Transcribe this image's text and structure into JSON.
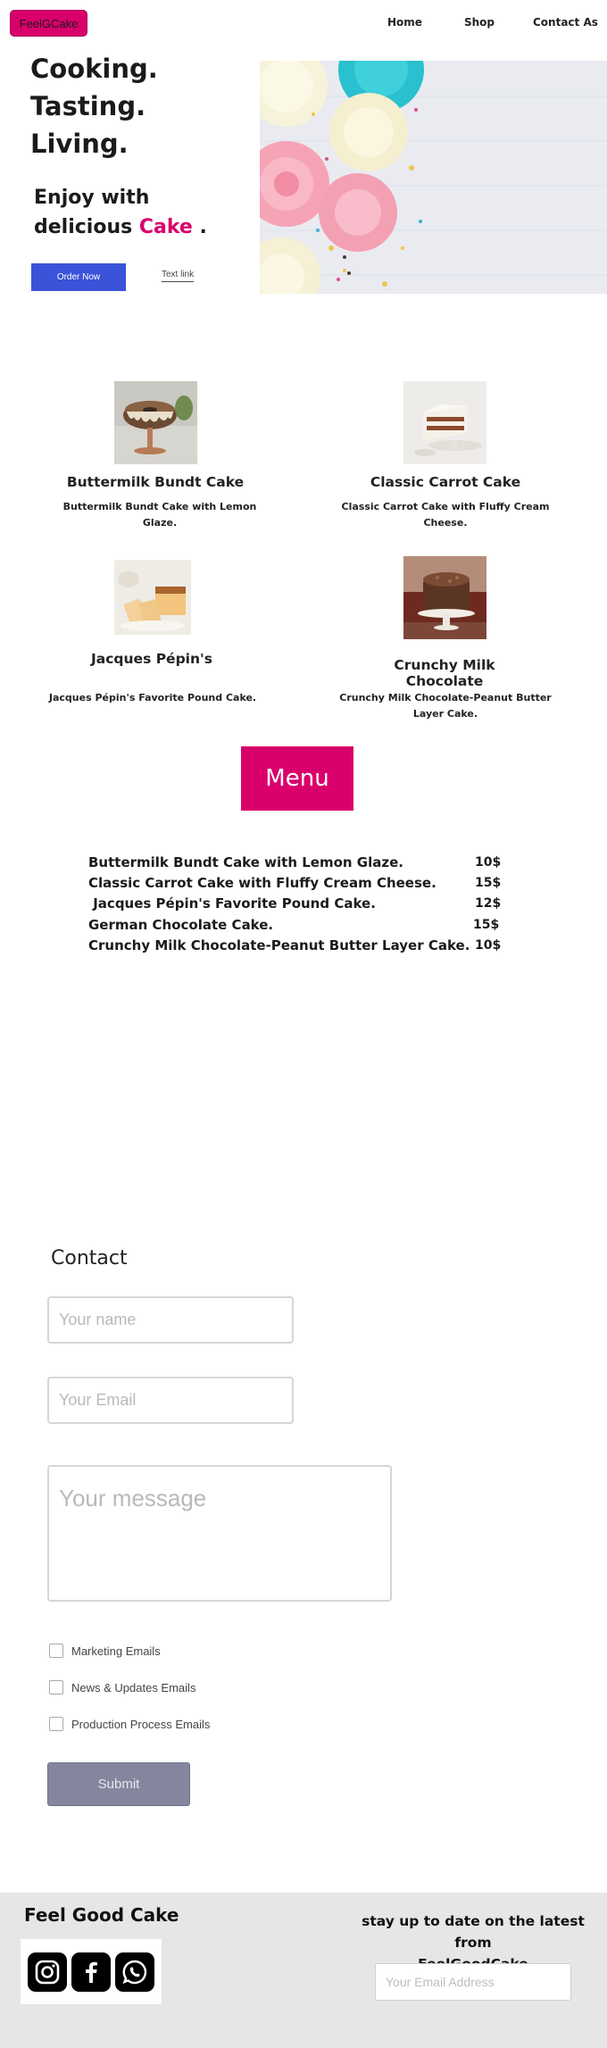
{
  "header": {
    "logo_text": "FeelGCake",
    "nav": [
      "Home",
      "Shop",
      "Contact As"
    ]
  },
  "hero": {
    "title_lines": [
      "Cooking.",
      "Tasting.",
      "Living."
    ],
    "subtitle_line1": "Enjoy with",
    "subtitle_prefix": "delicious ",
    "subtitle_accent": "Cake",
    "subtitle_suffix": " .",
    "primary_button": "Order Now",
    "text_link": "Text link",
    "image_icon": "cupcakes-photo"
  },
  "cakes": [
    {
      "title": "Buttermilk Bundt Cake",
      "description": "Buttermilk Bundt Cake with Lemon Glaze.",
      "image_icon": "bundt-cake-photo"
    },
    {
      "title": "Classic Carrot Cake",
      "description": "Classic Carrot Cake with Fluffy Cream Cheese.",
      "image_icon": "carrot-cake-photo"
    },
    {
      "title": "Jacques Pépin's",
      "description": "Jacques Pépin's Favorite Pound Cake.",
      "image_icon": "pound-cake-photo"
    },
    {
      "title": "Crunchy Milk Chocolate",
      "description": "Crunchy Milk Chocolate-Peanut Butter Layer Cake.",
      "image_icon": "chocolate-cake-photo"
    }
  ],
  "menu": {
    "title": "Menu",
    "items": [
      {
        "name": "Buttermilk Bundt Cake with Lemon Glaze.",
        "price": "10$"
      },
      {
        "name": "Classic Carrot Cake with Fluffy Cream Cheese.",
        "price": "15$"
      },
      {
        "name": " Jacques Pépin's Favorite Pound Cake.",
        "price": "12$"
      },
      {
        "name": "German Chocolate Cake.",
        "price": "15$"
      },
      {
        "name": "Crunchy Milk Chocolate-Peanut Butter Layer Cake.",
        "price": "10$"
      }
    ]
  },
  "contact": {
    "title": "Contact",
    "name_placeholder": "Your name",
    "email_placeholder": "Your Email",
    "message_placeholder": "Your message",
    "checkboxes": [
      "Marketing Emails",
      "News & Updates Emails",
      "Production Process Emails"
    ],
    "submit_label": "Submit"
  },
  "footer": {
    "brand": "Feel Good Cake",
    "social_icons": [
      "instagram-icon",
      "facebook-icon",
      "whatsapp-icon"
    ],
    "newsletter_line1": "stay up to date on the latest from",
    "newsletter_line2": "FeelGoodCake",
    "email_placeholder": "Your Email Address"
  },
  "colors": {
    "accent": "#d9006c",
    "primary_button": "#3a53d8",
    "submit_button": "#85859e",
    "footer_bg": "#e6e6e6"
  }
}
